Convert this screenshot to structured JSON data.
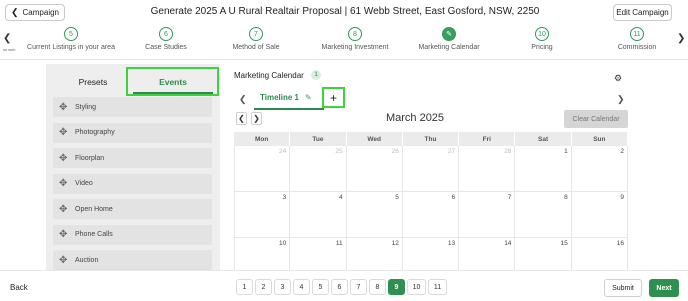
{
  "header": {
    "back_label": "Campaign",
    "title": "Generate 2025 A U Rural Realtair Proposal | 61 Webb Street, East Gosford, NSW, 2250",
    "edit_label": "Edit Campaign"
  },
  "stepper": {
    "mini_label": "ss web",
    "steps": [
      {
        "num": "5",
        "label": "Current Listings in your area"
      },
      {
        "num": "6",
        "label": "Case Studies"
      },
      {
        "num": "7",
        "label": "Method of Sale"
      },
      {
        "num": "8",
        "label": "Marketing Investment"
      },
      {
        "num": "",
        "label": "Marketing Calendar",
        "icon": "pencil-icon"
      },
      {
        "num": "10",
        "label": "Pricing"
      },
      {
        "num": "11",
        "label": "Commission"
      }
    ]
  },
  "left_panel": {
    "tabs": [
      {
        "label": "Presets"
      },
      {
        "label": "Events"
      }
    ],
    "items": [
      "Styling",
      "Photography",
      "Floorplan",
      "Video",
      "Open Home",
      "Phone Calls",
      "Auction"
    ]
  },
  "calendar": {
    "header_label": "Marketing Calendar",
    "count": "1",
    "timeline_tab": "Timeline 1",
    "month_title": "March 2025",
    "clear_label": "Clear Calendar",
    "weekdays": [
      "Mon",
      "Tue",
      "Wed",
      "Thu",
      "Fri",
      "Sat",
      "Sun"
    ],
    "weeks": [
      [
        "24",
        "25",
        "26",
        "27",
        "28",
        "1",
        "2"
      ],
      [
        "3",
        "4",
        "5",
        "6",
        "7",
        "8",
        "9"
      ],
      [
        "10",
        "11",
        "12",
        "13",
        "14",
        "15",
        "16"
      ]
    ]
  },
  "footer": {
    "back_label": "Back",
    "pages": [
      "1",
      "2",
      "3",
      "4",
      "5",
      "6",
      "7",
      "8",
      "9",
      "10",
      "11"
    ],
    "active_page": "9",
    "submit_label": "Submit",
    "next_label": "Next"
  },
  "colors": {
    "accent": "#2f8f4f",
    "highlight": "#3cd33c"
  }
}
